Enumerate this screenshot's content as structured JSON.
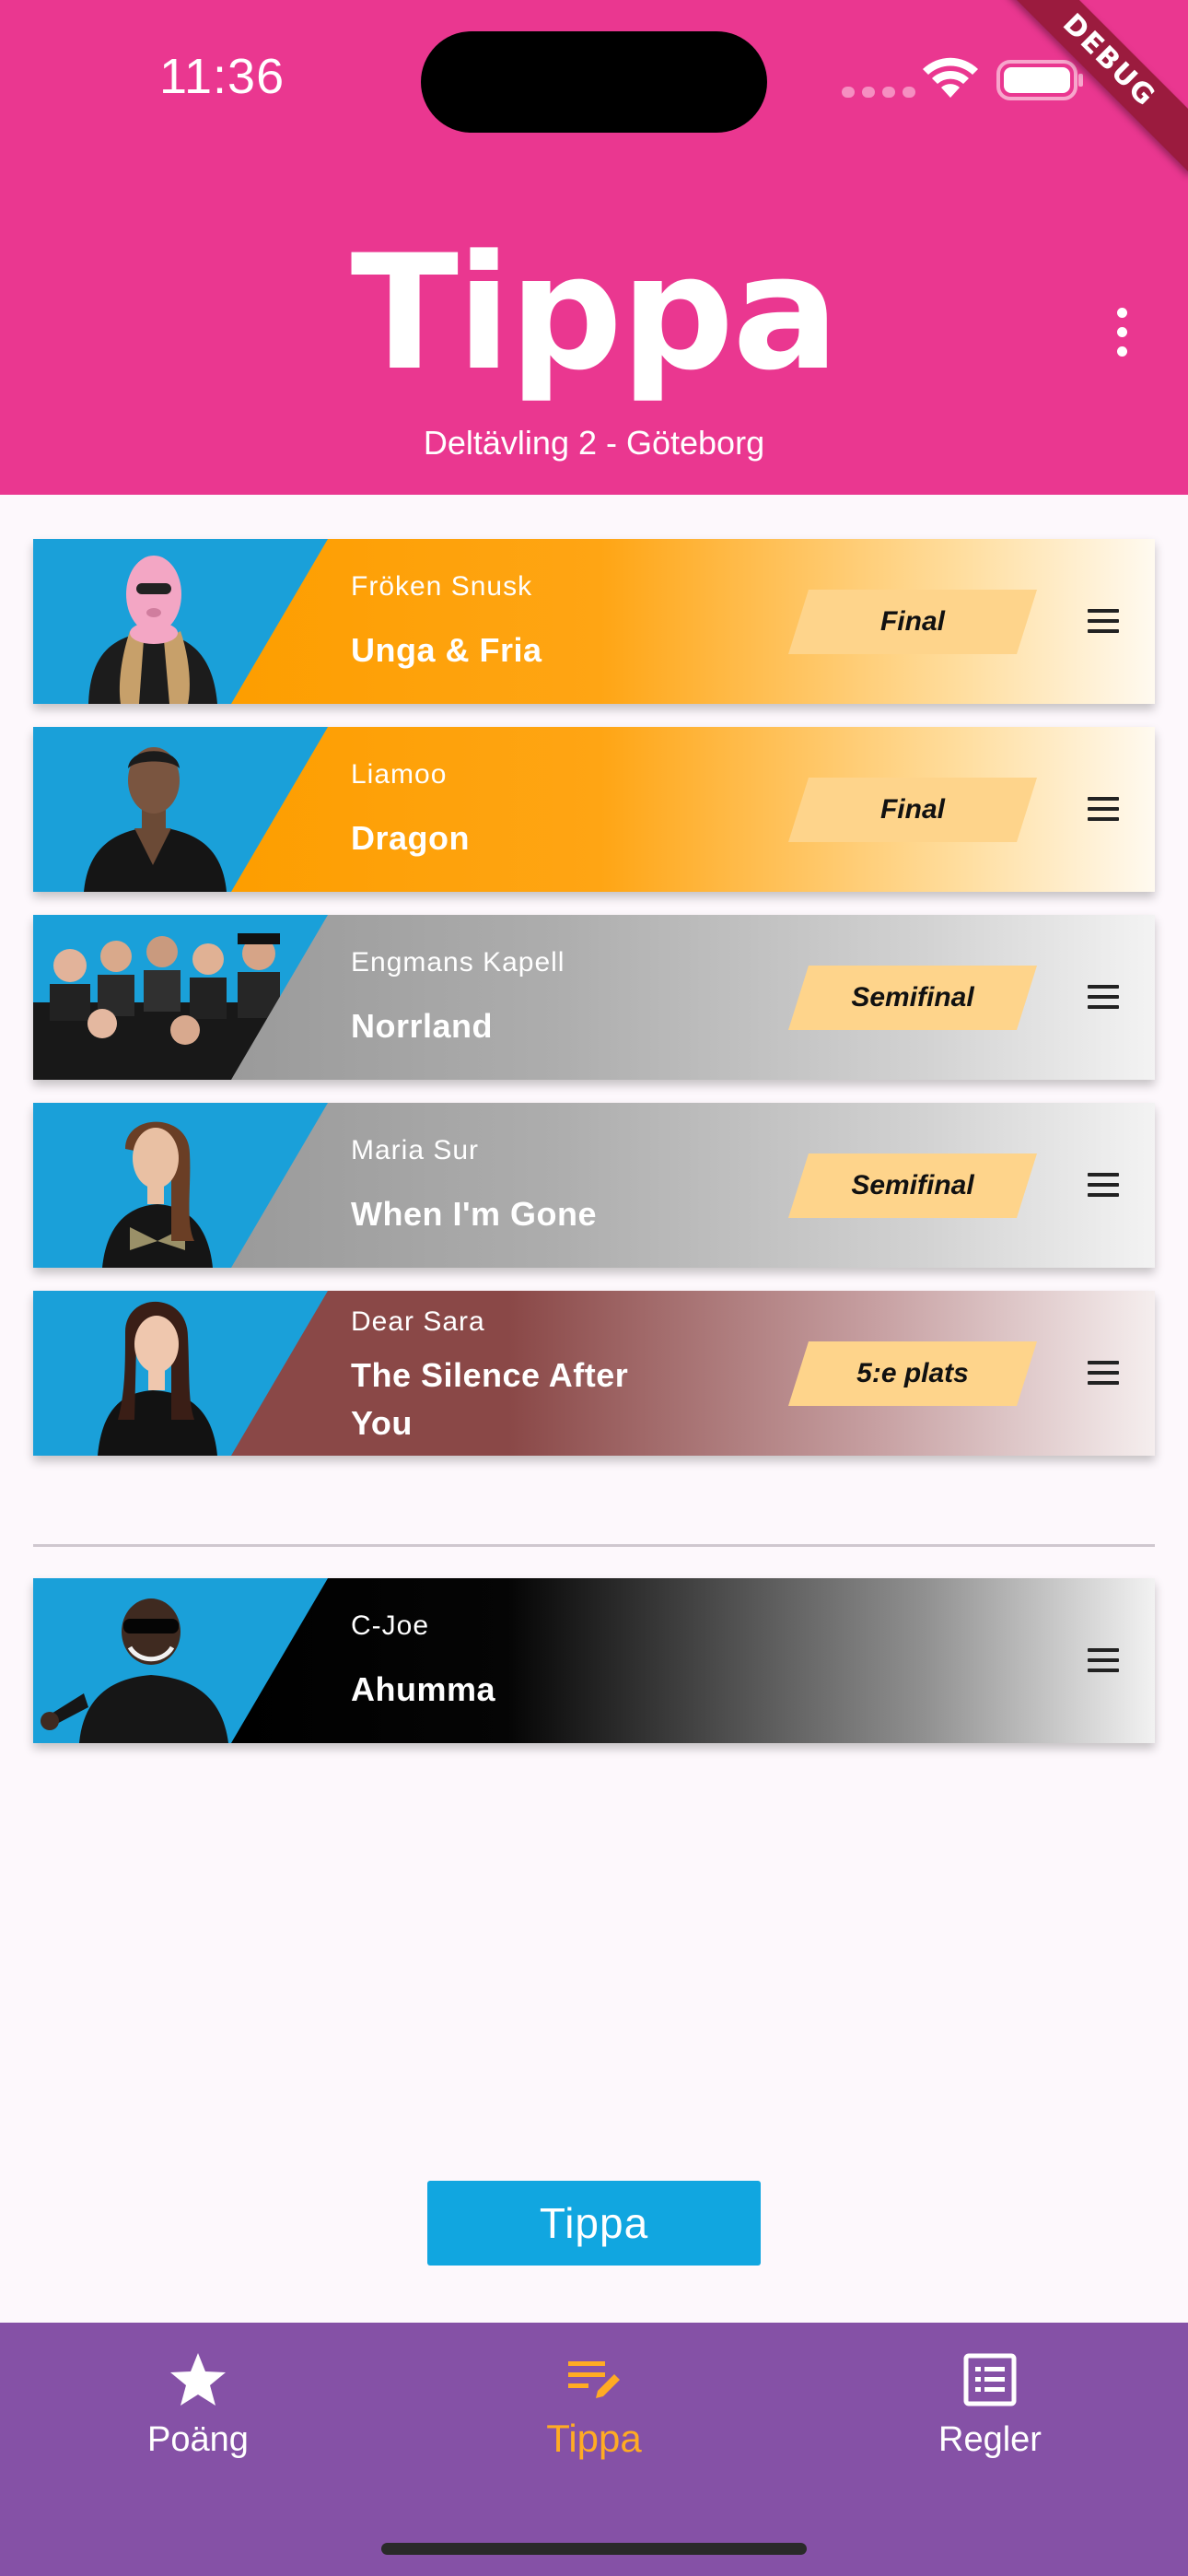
{
  "status_bar": {
    "time": "11:36",
    "debug_label": "DEBUG"
  },
  "header": {
    "title": "Tippa",
    "subtitle": "Deltävling 2 - Göteborg",
    "more_icon": "more-vert-icon",
    "background_color": "#ea3790"
  },
  "entries": [
    {
      "artist": "Fröken Snusk",
      "song": "Unga & Fria",
      "placement": "Final",
      "tier": "gold"
    },
    {
      "artist": "Liamoo",
      "song": "Dragon",
      "placement": "Final",
      "tier": "gold"
    },
    {
      "artist": "Engmans Kapell",
      "song": "Norrland",
      "placement": "Semifinal",
      "tier": "silver"
    },
    {
      "artist": "Maria Sur",
      "song": "When I'm Gone",
      "placement": "Semifinal",
      "tier": "silver"
    },
    {
      "artist": "Dear Sara",
      "song": "The Silence After You",
      "placement": "5:e plats",
      "tier": "bronze"
    }
  ],
  "eliminated_entries": [
    {
      "artist": "C-Joe",
      "song": "Ahumma",
      "tier": "black"
    }
  ],
  "submit_button": {
    "label": "Tippa",
    "color": "#11a6e0"
  },
  "bottom_nav": {
    "background_color": "#8551a6",
    "active_color": "#ffab23",
    "items": [
      {
        "label": "Poäng",
        "icon": "star-icon",
        "active": false
      },
      {
        "label": "Tippa",
        "icon": "edit-list-icon",
        "active": true
      },
      {
        "label": "Regler",
        "icon": "list-box-icon",
        "active": false
      }
    ]
  }
}
